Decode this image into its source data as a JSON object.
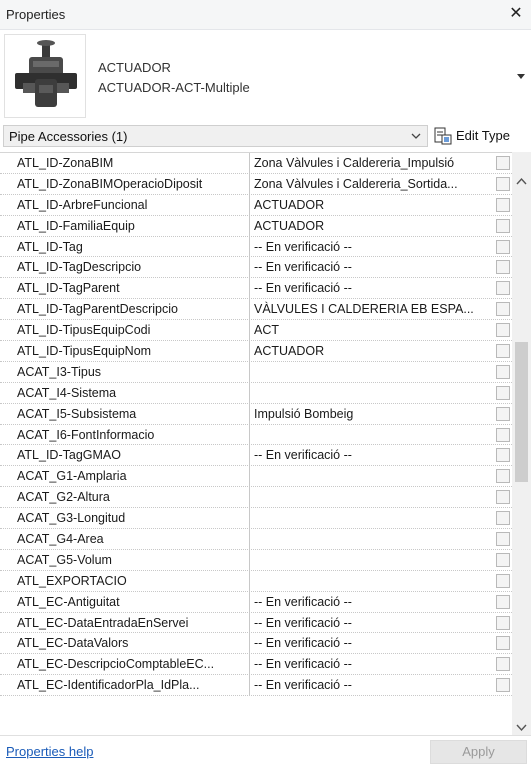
{
  "window": {
    "title": "Properties",
    "close_glyph": "✕"
  },
  "type_selector": {
    "family": "ACTUADOR",
    "type": "ACTUADOR-ACT-Multiple",
    "thumbnail_icon": "valve-actuator-icon"
  },
  "filter": {
    "selected": "Pipe Accessories (1)"
  },
  "edit_type": {
    "label": "Edit Type"
  },
  "parameters": [
    {
      "name": "ATL_ID-ZonaBIM",
      "value": "Zona Vàlvules i Caldereria_Impulsió"
    },
    {
      "name": "ATL_ID-ZonaBIMOperacioDiposit",
      "value": "Zona Vàlvules i Caldereria_Sortida..."
    },
    {
      "name": "ATL_ID-ArbreFuncional",
      "value": "ACTUADOR"
    },
    {
      "name": "ATL_ID-FamiliaEquip",
      "value": "ACTUADOR"
    },
    {
      "name": "ATL_ID-Tag",
      "value": "-- En verificació --"
    },
    {
      "name": "ATL_ID-TagDescripcio",
      "value": "-- En verificació --"
    },
    {
      "name": "ATL_ID-TagParent",
      "value": "-- En verificació --"
    },
    {
      "name": "ATL_ID-TagParentDescripcio",
      "value": "VÀLVULES I CALDERERIA EB ESPA..."
    },
    {
      "name": "ATL_ID-TipusEquipCodi",
      "value": "ACT"
    },
    {
      "name": "ATL_ID-TipusEquipNom",
      "value": "ACTUADOR"
    },
    {
      "name": "ACAT_I3-Tipus",
      "value": ""
    },
    {
      "name": "ACAT_I4-Sistema",
      "value": ""
    },
    {
      "name": "ACAT_I5-Subsistema",
      "value": "Impulsió Bombeig"
    },
    {
      "name": "ACAT_I6-FontInformacio",
      "value": ""
    },
    {
      "name": "ATL_ID-TagGMAO",
      "value": "-- En verificació --"
    },
    {
      "name": "ACAT_G1-Amplaria",
      "value": ""
    },
    {
      "name": "ACAT_G2-Altura",
      "value": ""
    },
    {
      "name": "ACAT_G3-Longitud",
      "value": ""
    },
    {
      "name": "ACAT_G4-Area",
      "value": ""
    },
    {
      "name": "ACAT_G5-Volum",
      "value": ""
    },
    {
      "name": "ATL_EXPORTACIO",
      "value": ""
    },
    {
      "name": "ATL_EC-Antiguitat",
      "value": "-- En verificació --"
    },
    {
      "name": "ATL_EC-DataEntradaEnServei",
      "value": "-- En verificació --"
    },
    {
      "name": "ATL_EC-DataValors",
      "value": "-- En verificació --"
    },
    {
      "name": "ATL_EC-DescripcioComptableEC...",
      "value": "-- En verificació --"
    },
    {
      "name": "ATL_EC-IdentificadorPla_IdPla...",
      "value": "-- En verificació --"
    }
  ],
  "footer": {
    "help_link": "Properties help",
    "apply_label": "Apply"
  },
  "colors": {
    "link": "#1a5bb8",
    "disabled_text": "#9a9a9a",
    "panel_bg": "#f5f6f7"
  }
}
